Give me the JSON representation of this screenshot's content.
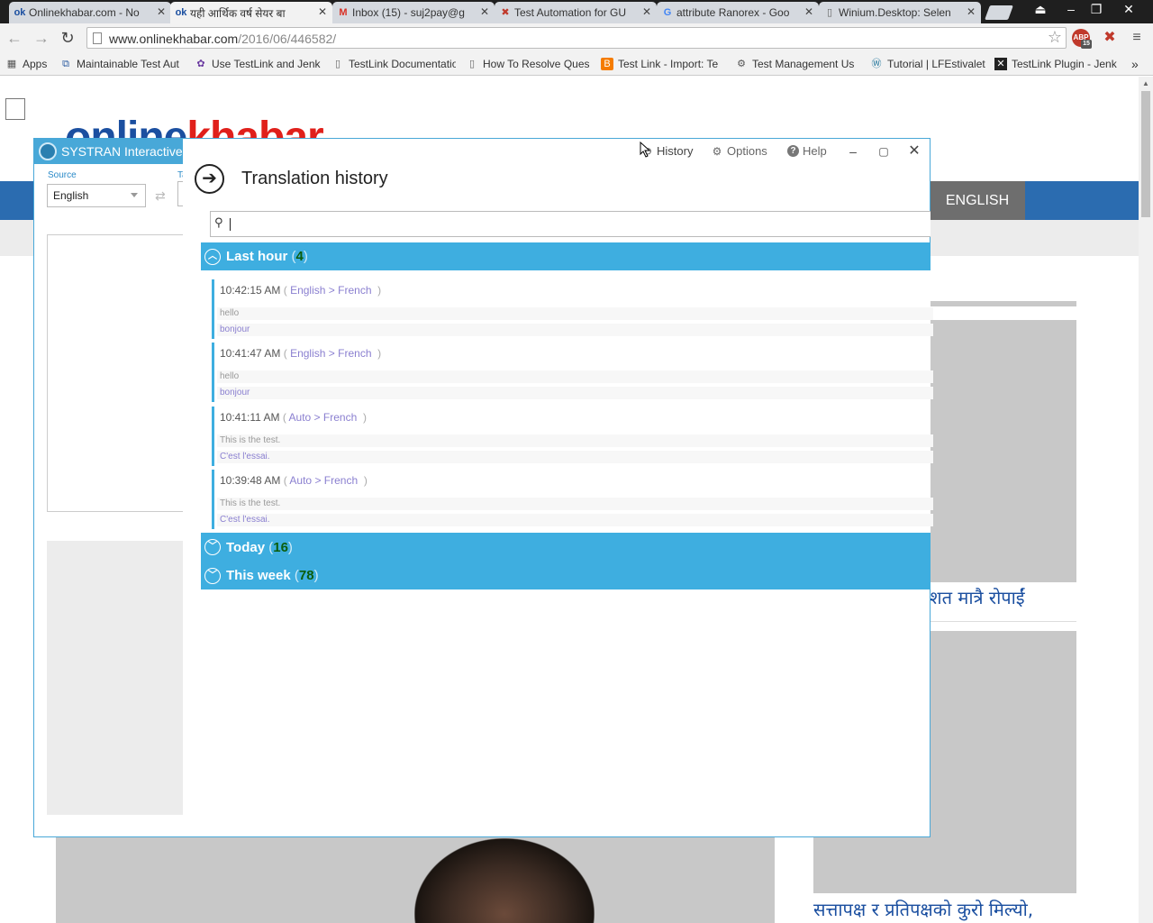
{
  "browser": {
    "tabs": [
      {
        "label": "Onlinekhabar.com - No",
        "icon": "onlinekhabar-icon"
      },
      {
        "label": "यही आर्थिक वर्ष सेयर बा",
        "icon": "onlinekhabar-icon"
      },
      {
        "label": "Inbox (15) - suj2pay@g",
        "icon": "gmail-icon"
      },
      {
        "label": "Test Automation for GU",
        "icon": "ranorex-icon"
      },
      {
        "label": "attribute Ranorex - Goo",
        "icon": "google-icon"
      },
      {
        "label": "Winium.Desktop: Selen",
        "icon": "page-icon"
      }
    ],
    "url_host": "www.onlinekhabar.com",
    "url_path": "/2016/06/446582/",
    "bookmarks": [
      "Apps",
      "Maintainable Test Aut",
      "Use TestLink and Jenk",
      "TestLink Documentatio",
      "How To Resolve Ques",
      "Test Link - Import: Te",
      "Test Management Us",
      "Tutorial | LFEstivalet",
      "TestLink Plugin - Jenk"
    ],
    "extension_badge": "ABP",
    "extension_count": "15"
  },
  "page": {
    "logo_part1": "online",
    "logo_part2": "khabar",
    "english_button": "ENGLISH",
    "headline_1": "शत मात्रै रोपाईं",
    "headline_2": "सत्तापक्ष र प्रतिपक्षको कुरो मिल्यो,"
  },
  "systran": {
    "title": "SYSTRAN Interactive",
    "source_label": "Source",
    "target_label": "Ta",
    "source_value": "English"
  },
  "history": {
    "buttons": {
      "history": "History",
      "options": "Options",
      "help": "Help"
    },
    "title": "Translation history",
    "search_placeholder": "",
    "groups": [
      {
        "label": "Last hour",
        "count": "4",
        "expanded": true
      },
      {
        "label": "Today",
        "count": "16",
        "expanded": false
      },
      {
        "label": "This week",
        "count": "78",
        "expanded": false
      }
    ],
    "entries": [
      {
        "time": "10:42:15 AM",
        "from": "English",
        "to": "French",
        "source": "hello",
        "target": "bonjour"
      },
      {
        "time": "10:41:47 AM",
        "from": "English",
        "to": "French",
        "source": "hello",
        "target": "bonjour"
      },
      {
        "time": "10:41:11 AM",
        "from": "Auto",
        "to": "French",
        "source": "This is the test.",
        "target": "C'est l'essai."
      },
      {
        "time": "10:39:48 AM",
        "from": "Auto",
        "to": "French",
        "source": "This is the test.",
        "target": "C'est l'essai."
      }
    ]
  },
  "colors": {
    "accent": "#3eaee0",
    "count": "#0b5d0b",
    "lang": "#8a7fd0"
  }
}
